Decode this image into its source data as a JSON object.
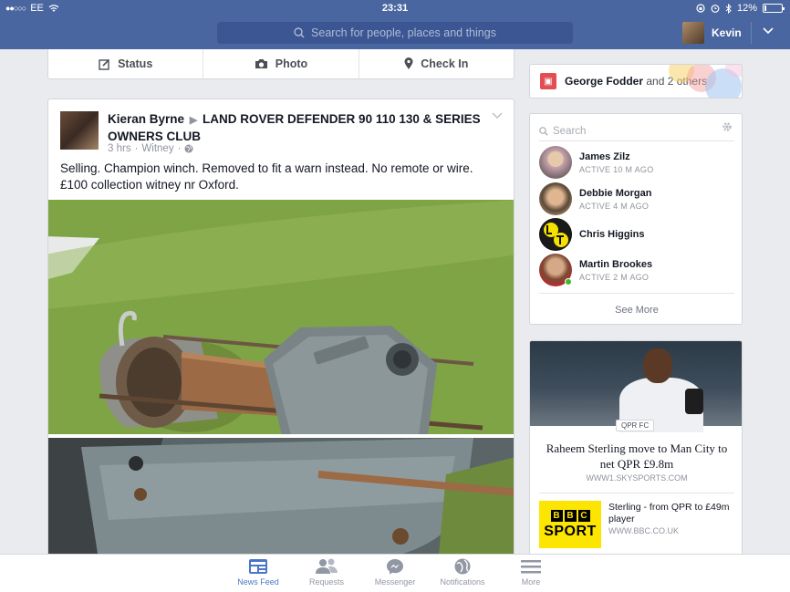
{
  "status_bar": {
    "carrier": "EE",
    "signal_dots": "●●○○○",
    "time": "23:31",
    "battery": "12%",
    "battery_level": 0.12
  },
  "nav": {
    "search_placeholder": "Search for people, places and things",
    "user_name": "Kevin"
  },
  "composer": {
    "status_label": "Status",
    "photo_label": "Photo",
    "checkin_label": "Check In"
  },
  "post": {
    "author": "Kieran Byrne",
    "group": "LAND ROVER DEFENDER 90 110 130 & SERIES OWNERS CLUB",
    "time": "3 hrs",
    "location": "Witney",
    "text": "Selling. Champion winch. Removed to fit a warn instead. No remote or wire. £100 collection witney nr Oxford."
  },
  "birthday": {
    "name": "George Fodder",
    "rest": "and 2 others"
  },
  "chat": {
    "search_placeholder": "Search",
    "friends": [
      {
        "name": "James Zilz",
        "active": "ACTIVE 10 M AGO"
      },
      {
        "name": "Debbie Morgan",
        "active": "ACTIVE 4 M AGO"
      },
      {
        "name": "Chris Higgins",
        "active": ""
      },
      {
        "name": "Martin Brookes",
        "active": "ACTIVE 2 M AGO"
      }
    ],
    "see_more": "See More"
  },
  "news": {
    "tag": "QPR FC",
    "title": "Raheem Sterling move to Man City to net QPR £9.8m",
    "url": "WWW1.SKYSPORTS.COM",
    "item2_title": "Sterling - from QPR to £49m player",
    "item2_url": "WWW.BBC.CO.UK",
    "bbc_letters": [
      "B",
      "B",
      "C"
    ],
    "bbc_sport": "SPORT"
  },
  "tabs": {
    "news_feed": "News Feed",
    "requests": "Requests",
    "messenger": "Messenger",
    "notifications": "Notifications",
    "more": "More"
  },
  "colors": {
    "brand": "#4a66a0",
    "active_tab": "#4a76c8",
    "online": "#42b72a"
  }
}
